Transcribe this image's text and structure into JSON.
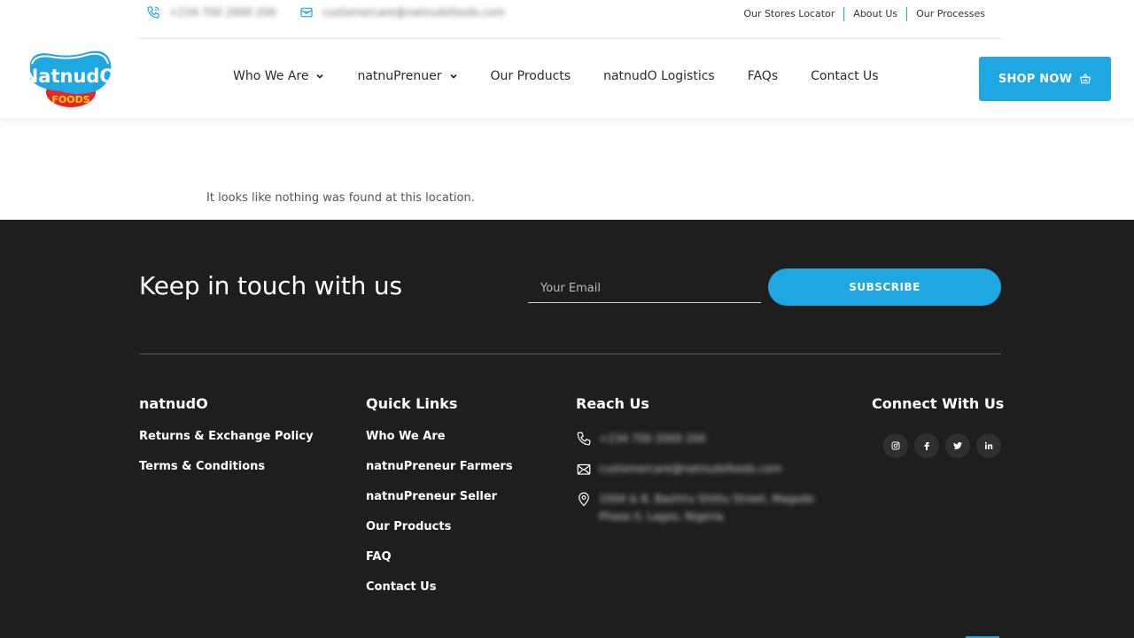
{
  "topbar": {
    "phone": "+234 700 2000 200",
    "email": "customercare@natnudofoods.com",
    "links": [
      "Our Stores Locator",
      "About Us",
      "Our Processes"
    ]
  },
  "logo": {
    "brand": "NatnudO",
    "sub": "FOODS"
  },
  "nav": {
    "items": [
      {
        "label": "Who We Are",
        "dropdown": true
      },
      {
        "label": "natnuPrenuer",
        "dropdown": true
      },
      {
        "label": "Our Products",
        "dropdown": false
      },
      {
        "label": "natnudO Logistics",
        "dropdown": false
      },
      {
        "label": "FAQs",
        "dropdown": false
      },
      {
        "label": "Contact Us",
        "dropdown": false
      }
    ],
    "shop_label": "SHOP NOW"
  },
  "main": {
    "message": "It looks like nothing was found at this location."
  },
  "footer": {
    "headline": "Keep in touch with us",
    "email_placeholder": "Your Email",
    "subscribe_label": "SUBSCRIBE",
    "col1": {
      "title": "natnudO",
      "items": [
        "Returns & Exchange Policy",
        "Terms & Conditions"
      ]
    },
    "col2": {
      "title": "Quick Links",
      "items": [
        "Who We Are",
        "natnuPreneur Farmers",
        "natnuPreneur Seller",
        "Our Products",
        "FAQ",
        "Contact Us"
      ]
    },
    "col3": {
      "title": "Reach Us",
      "phone": "+234 700 2000 200",
      "email": "customercare@natnudofoods.com",
      "address": "1004 & 8, Bashiru Shittu Street, Magodo Phase II, Lagos, Nigeria."
    },
    "col4": {
      "title": "Connect With Us",
      "socials": [
        "instagram-icon",
        "facebook-icon",
        "twitter-icon",
        "linkedin-icon"
      ]
    }
  },
  "colors": {
    "accent": "#1ea7e0",
    "footer_bg": "#1e1e1e",
    "logo_red": "#e8232a"
  }
}
